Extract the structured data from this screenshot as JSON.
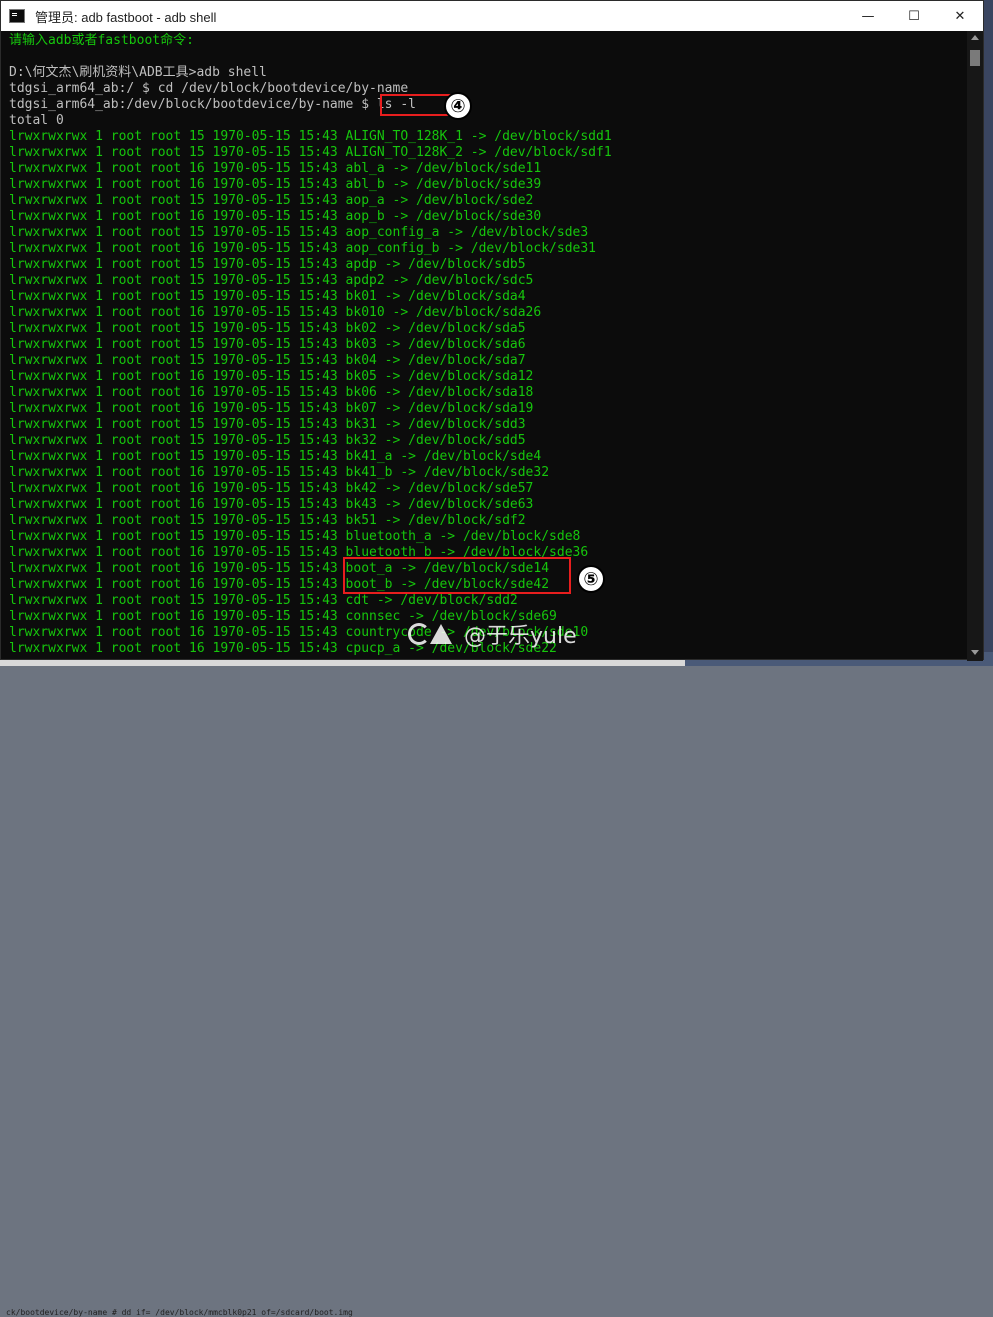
{
  "window": {
    "title": "管理员: adb fastboot - adb  shell",
    "minimize_glyph": "—",
    "maximize_glyph": "☐",
    "close_glyph": "✕"
  },
  "background_cmd": "ck/bootdevice/by-name # dd if= /dev/block/mmcblk0p21 of=/sdcard/boot.img",
  "console": {
    "prompt_message": "请输入adb或者fastboot命令:",
    "lines": [
      "D:\\何文杰\\刷机资料\\ADB工具>adb shell",
      "tdgsi_arm64_ab:/ $ cd /dev/block/bootdevice/by-name",
      "tdgsi_arm64_ab:/dev/block/bootdevice/by-name $ ls -l",
      "total 0"
    ],
    "listing": [
      "lrwxrwxrwx 1 root root 15 1970-05-15 15:43 ALIGN_TO_128K_1 -> /dev/block/sdd1",
      "lrwxrwxrwx 1 root root 15 1970-05-15 15:43 ALIGN_TO_128K_2 -> /dev/block/sdf1",
      "lrwxrwxrwx 1 root root 16 1970-05-15 15:43 abl_a -> /dev/block/sde11",
      "lrwxrwxrwx 1 root root 16 1970-05-15 15:43 abl_b -> /dev/block/sde39",
      "lrwxrwxrwx 1 root root 15 1970-05-15 15:43 aop_a -> /dev/block/sde2",
      "lrwxrwxrwx 1 root root 16 1970-05-15 15:43 aop_b -> /dev/block/sde30",
      "lrwxrwxrwx 1 root root 15 1970-05-15 15:43 aop_config_a -> /dev/block/sde3",
      "lrwxrwxrwx 1 root root 16 1970-05-15 15:43 aop_config_b -> /dev/block/sde31",
      "lrwxrwxrwx 1 root root 15 1970-05-15 15:43 apdp -> /dev/block/sdb5",
      "lrwxrwxrwx 1 root root 15 1970-05-15 15:43 apdp2 -> /dev/block/sdc5",
      "lrwxrwxrwx 1 root root 15 1970-05-15 15:43 bk01 -> /dev/block/sda4",
      "lrwxrwxrwx 1 root root 16 1970-05-15 15:43 bk010 -> /dev/block/sda26",
      "lrwxrwxrwx 1 root root 15 1970-05-15 15:43 bk02 -> /dev/block/sda5",
      "lrwxrwxrwx 1 root root 15 1970-05-15 15:43 bk03 -> /dev/block/sda6",
      "lrwxrwxrwx 1 root root 15 1970-05-15 15:43 bk04 -> /dev/block/sda7",
      "lrwxrwxrwx 1 root root 16 1970-05-15 15:43 bk05 -> /dev/block/sda12",
      "lrwxrwxrwx 1 root root 16 1970-05-15 15:43 bk06 -> /dev/block/sda18",
      "lrwxrwxrwx 1 root root 16 1970-05-15 15:43 bk07 -> /dev/block/sda19",
      "lrwxrwxrwx 1 root root 15 1970-05-15 15:43 bk31 -> /dev/block/sdd3",
      "lrwxrwxrwx 1 root root 15 1970-05-15 15:43 bk32 -> /dev/block/sdd5",
      "lrwxrwxrwx 1 root root 15 1970-05-15 15:43 bk41_a -> /dev/block/sde4",
      "lrwxrwxrwx 1 root root 16 1970-05-15 15:43 bk41_b -> /dev/block/sde32",
      "lrwxrwxrwx 1 root root 16 1970-05-15 15:43 bk42 -> /dev/block/sde57",
      "lrwxrwxrwx 1 root root 16 1970-05-15 15:43 bk43 -> /dev/block/sde63",
      "lrwxrwxrwx 1 root root 15 1970-05-15 15:43 bk51 -> /dev/block/sdf2",
      "lrwxrwxrwx 1 root root 15 1970-05-15 15:43 bluetooth_a -> /dev/block/sde8",
      "lrwxrwxrwx 1 root root 16 1970-05-15 15:43 bluetooth_b -> /dev/block/sde36",
      "lrwxrwxrwx 1 root root 16 1970-05-15 15:43 boot_a -> /dev/block/sde14",
      "lrwxrwxrwx 1 root root 16 1970-05-15 15:43 boot_b -> /dev/block/sde42",
      "lrwxrwxrwx 1 root root 15 1970-05-15 15:43 cdt -> /dev/block/sdd2",
      "lrwxrwxrwx 1 root root 16 1970-05-15 15:43 connsec -> /dev/block/sde69",
      "lrwxrwxrwx 1 root root 16 1970-05-15 15:43 countrycode -> /dev/block/sde10",
      "lrwxrwxrwx 1 root root 16 1970-05-15 15:43 cpucp_a -> /dev/block/sde22"
    ]
  },
  "annotations": {
    "step4": "④",
    "step5": "⑤"
  },
  "watermark": {
    "text": "@于乐yule"
  },
  "colors": {
    "terminal_bg": "#0c0c0c",
    "terminal_green": "#16c60c",
    "highlight_red": "#e81e1e"
  }
}
